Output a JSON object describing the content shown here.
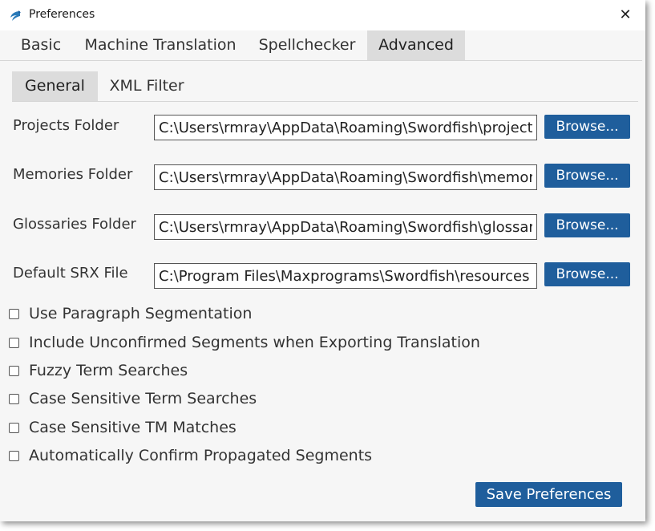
{
  "window": {
    "title": "Preferences",
    "close_icon": "close-icon",
    "app_icon": "swordfish-logo-icon"
  },
  "tabs_main": [
    {
      "label": "Basic"
    },
    {
      "label": "Machine Translation"
    },
    {
      "label": "Spellchecker"
    },
    {
      "label": "Advanced",
      "active": true
    }
  ],
  "tabs_sub": [
    {
      "label": "General",
      "active": true
    },
    {
      "label": "XML Filter"
    }
  ],
  "folders": [
    {
      "label": "Projects Folder",
      "value": "C:\\Users\\rmray\\AppData\\Roaming\\Swordfish\\projects",
      "button": "Browse..."
    },
    {
      "label": "Memories Folder",
      "value": "C:\\Users\\rmray\\AppData\\Roaming\\Swordfish\\memories",
      "button": "Browse..."
    },
    {
      "label": "Glossaries Folder",
      "value": "C:\\Users\\rmray\\AppData\\Roaming\\Swordfish\\glossaries",
      "button": "Browse..."
    },
    {
      "label": "Default SRX File",
      "value": "C:\\Program Files\\Maxprograms\\Swordfish\\resources",
      "button": "Browse..."
    }
  ],
  "options": [
    {
      "label": "Use Paragraph Segmentation",
      "checked": false
    },
    {
      "label": "Include Unconfirmed Segments when Exporting Translation",
      "checked": false
    },
    {
      "label": "Fuzzy Term Searches",
      "checked": false
    },
    {
      "label": "Case Sensitive Term Searches",
      "checked": false
    },
    {
      "label": "Case Sensitive TM Matches",
      "checked": false
    },
    {
      "label": "Automatically Confirm Propagated Segments",
      "checked": false
    }
  ],
  "save_label": "Save Preferences",
  "colors": {
    "button": "#1f5e9c",
    "active_tab": "#dcdcdc",
    "background": "#f6f6f6"
  }
}
